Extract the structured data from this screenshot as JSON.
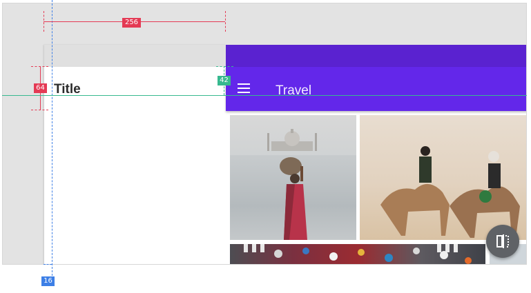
{
  "drawer": {
    "title": "Title"
  },
  "app_bar": {
    "title": "Travel",
    "menu_icon": "hamburger-menu-icon"
  },
  "photos": [
    {
      "name": "taj-mahal-photo"
    },
    {
      "name": "camel-riders-photo"
    },
    {
      "name": "umbrella-crowd-photo"
    },
    {
      "name": "partial-photo"
    }
  ],
  "fab": {
    "icon": "split-screen-icon"
  },
  "redlines": {
    "drawer_width": "256",
    "app_bar_height": "64",
    "title_baseline": "42",
    "keyline": "16"
  },
  "colors": {
    "status_bar": "#5a22d0",
    "app_bar": "#6327ea",
    "redline_red": "#e43a54",
    "redline_teal": "#37b98f",
    "redline_blue": "#3d7fe6",
    "fab": "#5f6266"
  }
}
